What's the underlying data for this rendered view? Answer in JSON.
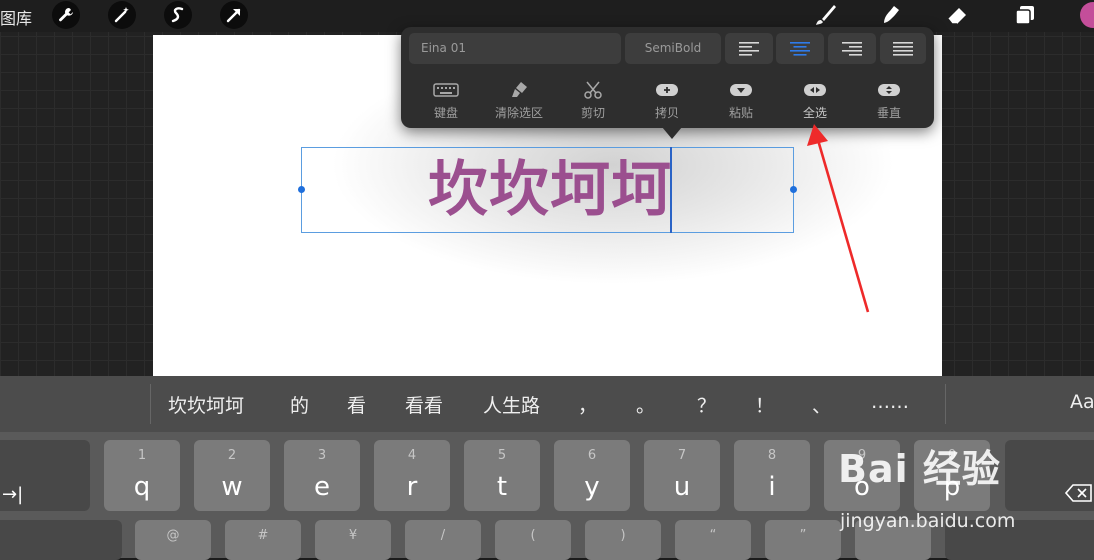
{
  "app": {
    "gallery_label": "图库"
  },
  "topbar": {
    "left_tools": [
      "wrench-icon",
      "magic-wand-icon",
      "selection-icon",
      "transform-arrow-icon"
    ],
    "right_tools": [
      "brush-icon",
      "smudge-icon",
      "eraser-icon",
      "layers-icon"
    ],
    "current_color": "#c44e9a"
  },
  "text_popup": {
    "font_name": "Eina 01",
    "font_weight": "SemiBold",
    "alignment_options": [
      "left",
      "center",
      "right",
      "justify"
    ],
    "selected_alignment": "center",
    "tools": [
      {
        "label": "键盘",
        "icon": "keyboard-icon"
      },
      {
        "label": "清除选区",
        "icon": "clear-selection-icon"
      },
      {
        "label": "剪切",
        "icon": "scissors-icon"
      },
      {
        "label": "拷贝",
        "icon": "copy-icon"
      },
      {
        "label": "粘贴",
        "icon": "paste-icon"
      },
      {
        "label": "全选",
        "icon": "select-all-icon"
      },
      {
        "label": "垂直",
        "icon": "vertical-icon"
      }
    ]
  },
  "canvas": {
    "text": "坎坎坷坷",
    "text_color": "#9b4f8f"
  },
  "keyboard": {
    "suggestions": [
      "坎坎坷坷",
      "的",
      "看",
      "看看",
      "人生路",
      "，",
      "。",
      "？",
      "！",
      "、",
      "……"
    ],
    "format_label": "Aa",
    "tab_label": "→|",
    "row1": [
      {
        "num": "1",
        "ch": "q"
      },
      {
        "num": "2",
        "ch": "w"
      },
      {
        "num": "3",
        "ch": "e"
      },
      {
        "num": "4",
        "ch": "r"
      },
      {
        "num": "5",
        "ch": "t"
      },
      {
        "num": "6",
        "ch": "y"
      },
      {
        "num": "7",
        "ch": "u"
      },
      {
        "num": "8",
        "ch": "i"
      },
      {
        "num": "9",
        "ch": "o"
      },
      {
        "num": "0",
        "ch": "p"
      }
    ],
    "row2_alts": [
      "@",
      "#",
      "¥",
      "/",
      "(",
      ")",
      "“",
      "”"
    ]
  },
  "watermark": {
    "brand": "Bai 经验",
    "url": "jingyan.baidu.com"
  }
}
